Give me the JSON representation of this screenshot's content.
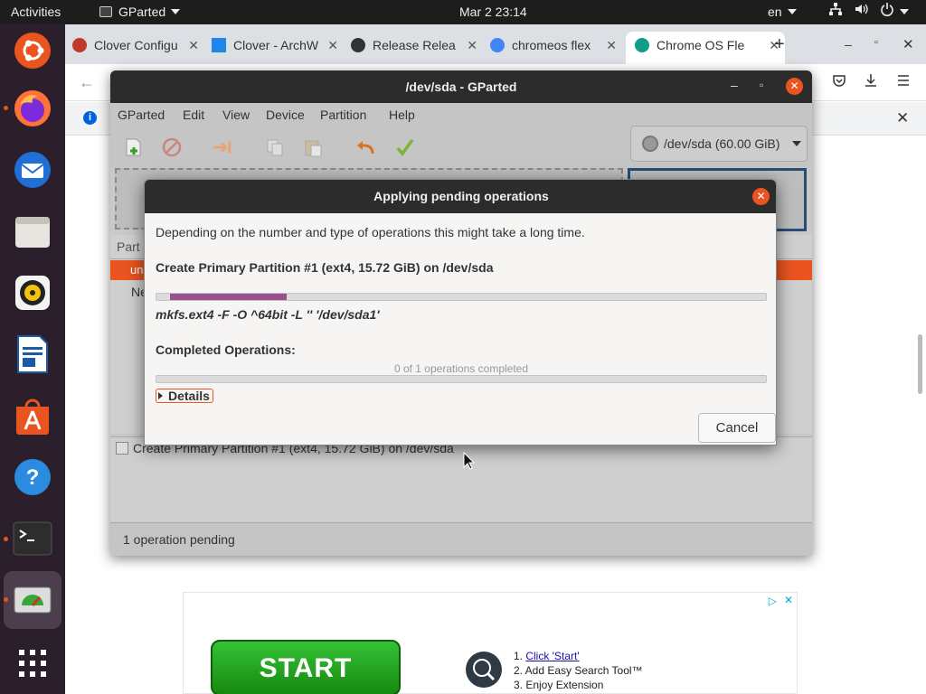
{
  "topbar": {
    "activities": "Activities",
    "app_name": "GParted",
    "clock": "Mar 2  23:14",
    "input_lang": "en"
  },
  "browser": {
    "tabs": [
      {
        "label": "Clover Configu",
        "favicon_color": "#c0392b"
      },
      {
        "label": "Clover - ArchW",
        "favicon_color": "#1e88e5"
      },
      {
        "label": "Release Relea",
        "favicon_color": "#333333"
      },
      {
        "label": "chromeos flex",
        "favicon_color": "#4285f4"
      },
      {
        "label": "Chrome OS Fle",
        "favicon_color": "#0f9d8a",
        "active": true
      }
    ]
  },
  "gparted": {
    "title": "/dev/sda - GParted",
    "menu": [
      "GParted",
      "Edit",
      "View",
      "Device",
      "Partition",
      "Help"
    ],
    "device_selector": "/dev/sda (60.00 GiB)",
    "list_header": "Part",
    "list_selected": "un",
    "list_row2": "Ne",
    "pending_op": "Create Primary Partition #1 (ext4, 15.72 GiB) on /dev/sda",
    "status": "1 operation pending"
  },
  "dialog": {
    "title": "Applying pending operations",
    "description": "Depending on the number and type of operations this might take a long time.",
    "current_operation": "Create Primary Partition #1 (ext4, 15.72 GiB) on /dev/sda",
    "current_progress": 0.2,
    "command": "mkfs.ext4 -F -O ^64bit -L '' '/dev/sda1'",
    "completed_heading": "Completed Operations:",
    "completed_count": "0 of 1 operations completed",
    "overall_progress": 0,
    "details_label": "Details",
    "cancel_label": "Cancel"
  },
  "ad": {
    "start_label": "START",
    "step1_prefix": "1. ",
    "step1_link": "Click 'Start'",
    "step2": "2. Add Easy Search Tool™",
    "step3": "3. Enjoy Extension"
  },
  "colors": {
    "accent": "#e95420",
    "progress_fill": "#99508a",
    "dock_bg": "#2a1f2b"
  }
}
